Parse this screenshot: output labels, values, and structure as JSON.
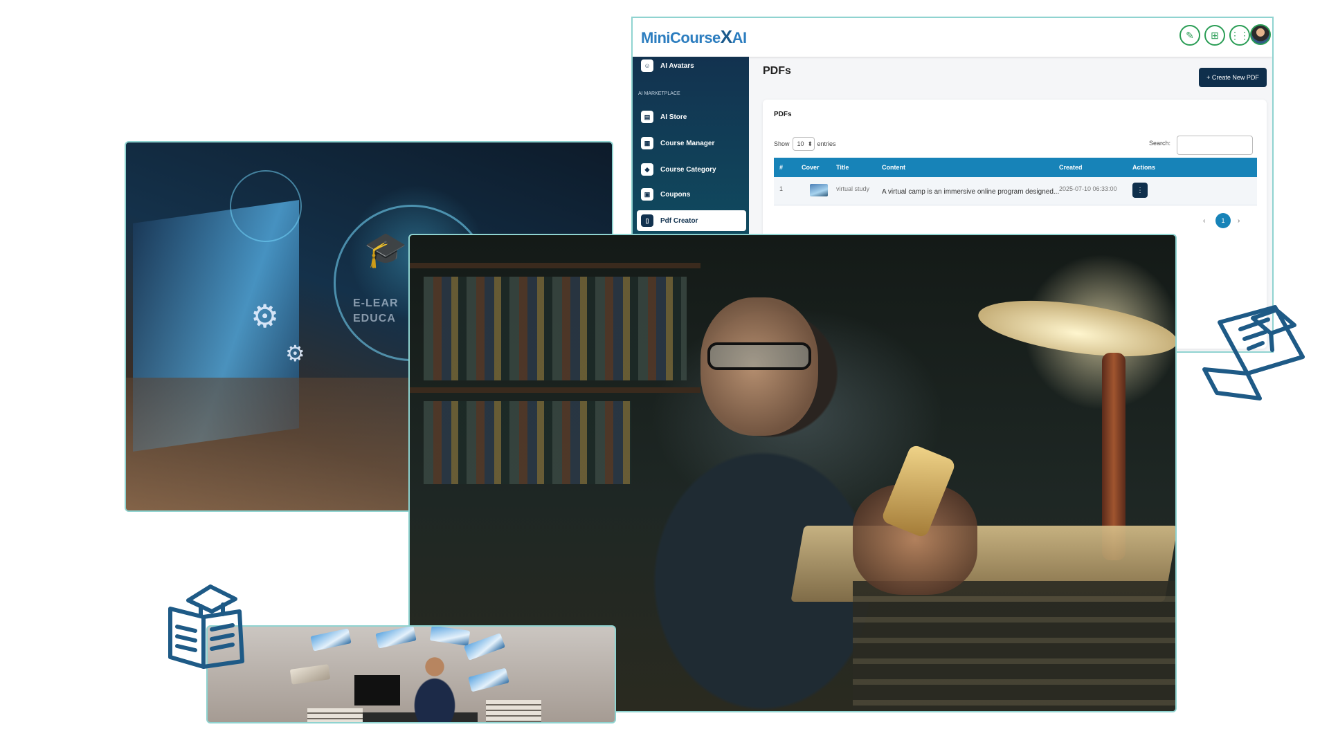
{
  "app": {
    "logo_text": "MiniCourse",
    "logo_x": "X",
    "logo_ai": "AI",
    "topbar_icons": [
      "magic-wand-icon",
      "gift-icon",
      "apps-grid-icon"
    ],
    "sidebar": {
      "partial_item": "AI Avatars",
      "section_label": "AI MARKETPLACE",
      "items": [
        {
          "label": "AI Store",
          "icon": "store-icon"
        },
        {
          "label": "Course Manager",
          "icon": "course-manager-icon"
        },
        {
          "label": "Course Category",
          "icon": "tag-icon"
        },
        {
          "label": "Coupons",
          "icon": "coupon-icon"
        },
        {
          "label": "Pdf Creator",
          "icon": "pdf-icon",
          "active": true
        }
      ]
    },
    "page_title": "PDFs",
    "create_button": "+ Create New PDF",
    "card": {
      "title": "PDFs",
      "show_label": "Show",
      "entries_value": "10",
      "entries_label": "entries",
      "search_label": "Search:",
      "search_value": "",
      "columns": [
        "#",
        "Cover",
        "Title",
        "Content",
        "Created",
        "Actions"
      ],
      "rows": [
        {
          "index": "1",
          "title": "virtual study",
          "content": "A virtual camp is an immersive online program designed...",
          "created": "2025-07-10 06:33:00",
          "action": "⋮"
        }
      ],
      "pagination": {
        "prev": "‹",
        "current": "1",
        "next": "›"
      }
    }
  },
  "photos": {
    "laptop_overlay_text_line1": "E-LEAR",
    "laptop_overlay_text_line2": "EDUCA"
  },
  "accent_colors": {
    "frame_border": "#8fd3d0",
    "sidebar_dark": "#12324f",
    "table_header": "#1783b8",
    "icon_green": "#2a9d55",
    "line_icon_blue": "#1e5a86"
  }
}
